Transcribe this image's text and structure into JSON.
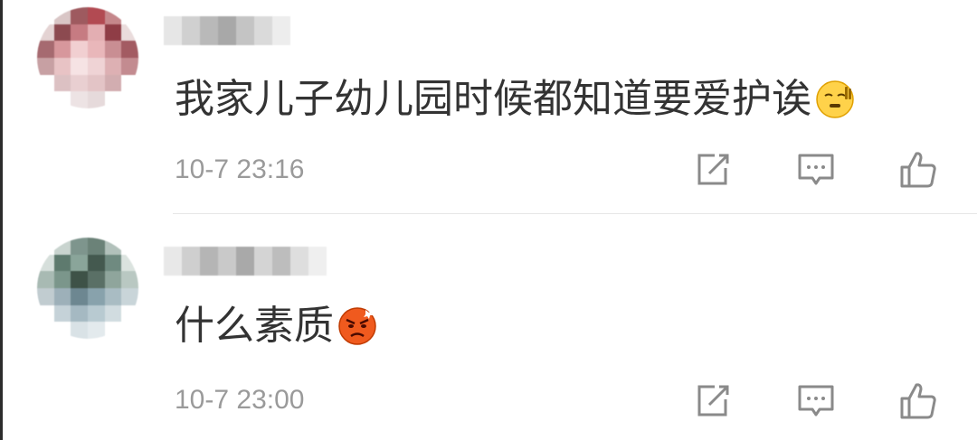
{
  "comments": [
    {
      "text": "我家儿子幼儿园时候都知道要爱护诶",
      "emoji": "sleepy-face-emoji",
      "time": "10-7 23:16",
      "avatar_colors": [
        "#ffffff",
        "#d9c6c6",
        "#9e5a5f",
        "#b24a52",
        "#c5878b",
        "#ffffff",
        "#e4d3d3",
        "#8c4a50",
        "#c67b82",
        "#e3aeb2",
        "#8f3d46",
        "#eadcdc",
        "#a66a70",
        "#d7979c",
        "#f1cfd1",
        "#e9b7ba",
        "#c98e93",
        "#a35b62",
        "#c7a0a3",
        "#e8c3c5",
        "#f6e3e4",
        "#efd3d5",
        "#ddb0b3",
        "#c38b90",
        "#ffffff",
        "#dcc1c3",
        "#e9cfd1",
        "#e3c4c6",
        "#d2adb0",
        "#ffffff",
        "#ffffff",
        "#ffffff",
        "#ede3e4",
        "#e6dadb",
        "#ffffff",
        "#ffffff"
      ],
      "name_colors": [
        "#e6e6e6",
        "#d0d0d0",
        "#b9b9b9",
        "#a8a8a8",
        "#c4c4c4",
        "#dadada",
        "#ededed"
      ]
    },
    {
      "text": "什么素质",
      "emoji": "angry-face-emoji",
      "time": "10-7 23:00",
      "avatar_colors": [
        "#ffffff",
        "#c9d4cf",
        "#7e958d",
        "#6b8278",
        "#b2c1bb",
        "#ffffff",
        "#d6dfdb",
        "#5e7a6e",
        "#8aa59a",
        "#44594f",
        "#6f8a80",
        "#dbe3df",
        "#a8bab3",
        "#7b968b",
        "#3e5247",
        "#5a7066",
        "#8fa59c",
        "#b9c8c2",
        "#c1ccd0",
        "#9db0b9",
        "#6d8791",
        "#88a2ac",
        "#a9bcc3",
        "#c9d5d9",
        "#ffffff",
        "#c5d2d8",
        "#a5b9c2",
        "#b8cad1",
        "#d1dce0",
        "#ffffff",
        "#ffffff",
        "#ffffff",
        "#d9e2e6",
        "#e3eaed",
        "#ffffff",
        "#ffffff"
      ],
      "name_colors": [
        "#e8e8e8",
        "#cfcfcf",
        "#b5b5b5",
        "#c9c9c9",
        "#a9a9a9",
        "#d4d4d4",
        "#bdbdbd",
        "#dedede",
        "#efefef"
      ]
    }
  ],
  "icons": {
    "share": "share-icon",
    "reply": "comment-icon",
    "like": "thumbs-up-icon"
  },
  "colors": {
    "text": "#333333",
    "meta": "#9a9a9a",
    "icon": "#8a8a8a",
    "divider": "#e6e6e6"
  }
}
